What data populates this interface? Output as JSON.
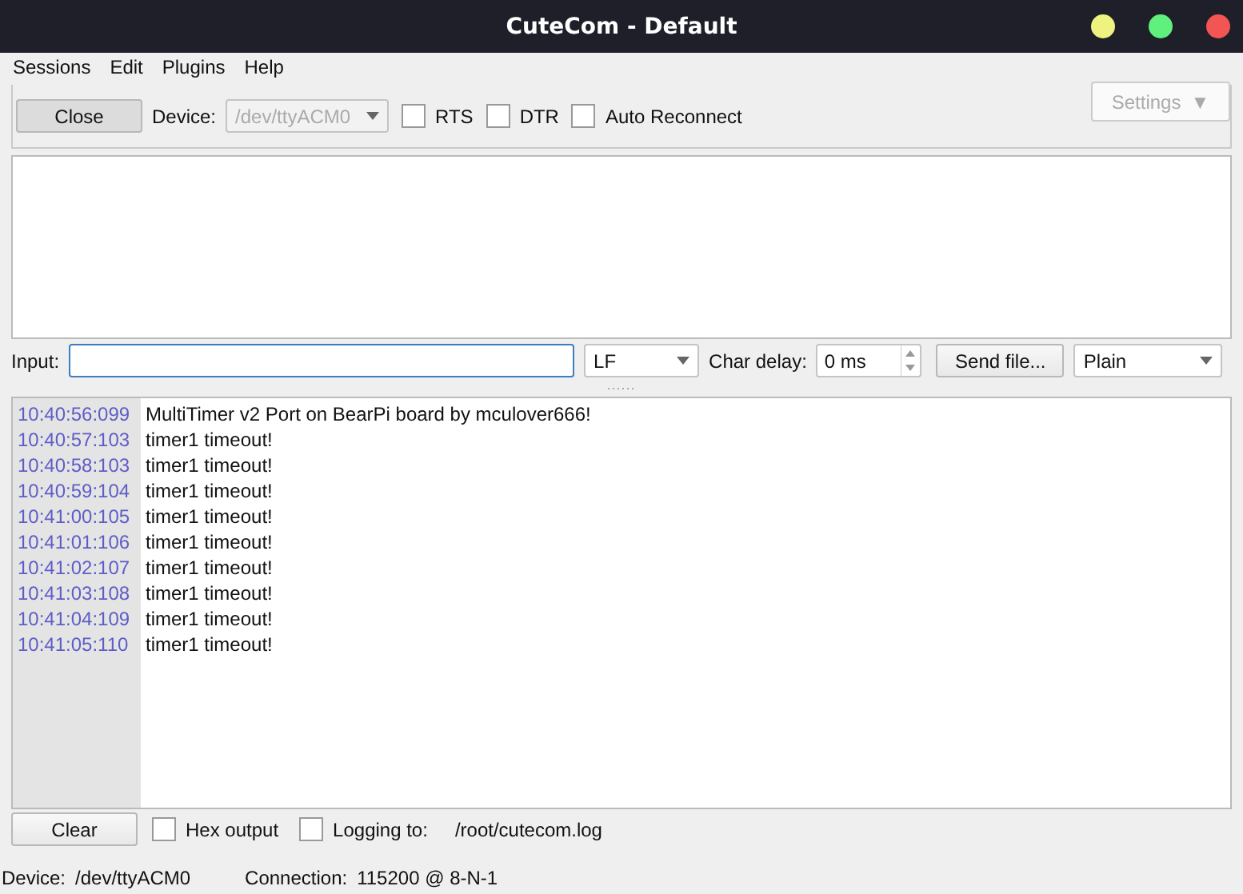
{
  "window": {
    "title": "CuteCom - Default"
  },
  "menu": [
    "Sessions",
    "Edit",
    "Plugins",
    "Help"
  ],
  "controls": {
    "close_button": "Close",
    "device_label": "Device:",
    "device_value": "/dev/ttyACM0",
    "device_disabled": true,
    "checks": [
      {
        "label": "RTS",
        "checked": false
      },
      {
        "label": "DTR",
        "checked": false
      },
      {
        "label": "Auto Reconnect",
        "checked": false
      }
    ],
    "settings_button": "Settings",
    "settings_arrow": "▼"
  },
  "input_row": {
    "label": "Input:",
    "line_end": "LF",
    "char_delay_label": "Char delay:",
    "char_delay": "0 ms",
    "send_file": "Send file...",
    "mode": "Plain"
  },
  "log": [
    {
      "time": "10:40:56:099",
      "text": "MultiTimer v2 Port on BearPi board by mculover666!"
    },
    {
      "time": "10:40:57:103",
      "text": "timer1 timeout!"
    },
    {
      "time": "10:40:58:103",
      "text": "timer1 timeout!"
    },
    {
      "time": "10:40:59:104",
      "text": "timer1 timeout!"
    },
    {
      "time": "10:41:00:105",
      "text": "timer1 timeout!"
    },
    {
      "time": "10:41:01:106",
      "text": "timer1 timeout!"
    },
    {
      "time": "10:41:02:107",
      "text": "timer1 timeout!"
    },
    {
      "time": "10:41:03:108",
      "text": "timer1 timeout!"
    },
    {
      "time": "10:41:04:109",
      "text": "timer1 timeout!"
    },
    {
      "time": "10:41:05:110",
      "text": "timer1 timeout!"
    }
  ],
  "bottom": {
    "clear_button": "Clear",
    "hex_output": {
      "label": "Hex output",
      "checked": false
    },
    "logging": {
      "label": "Logging to:",
      "checked": false
    },
    "log_path": "/root/cutecom.log"
  },
  "status_bar": {
    "device_label": "Device:",
    "device": "/dev/ttyACM0",
    "connection_label": "Connection:",
    "connection": "115200 @ 8-N-1"
  }
}
